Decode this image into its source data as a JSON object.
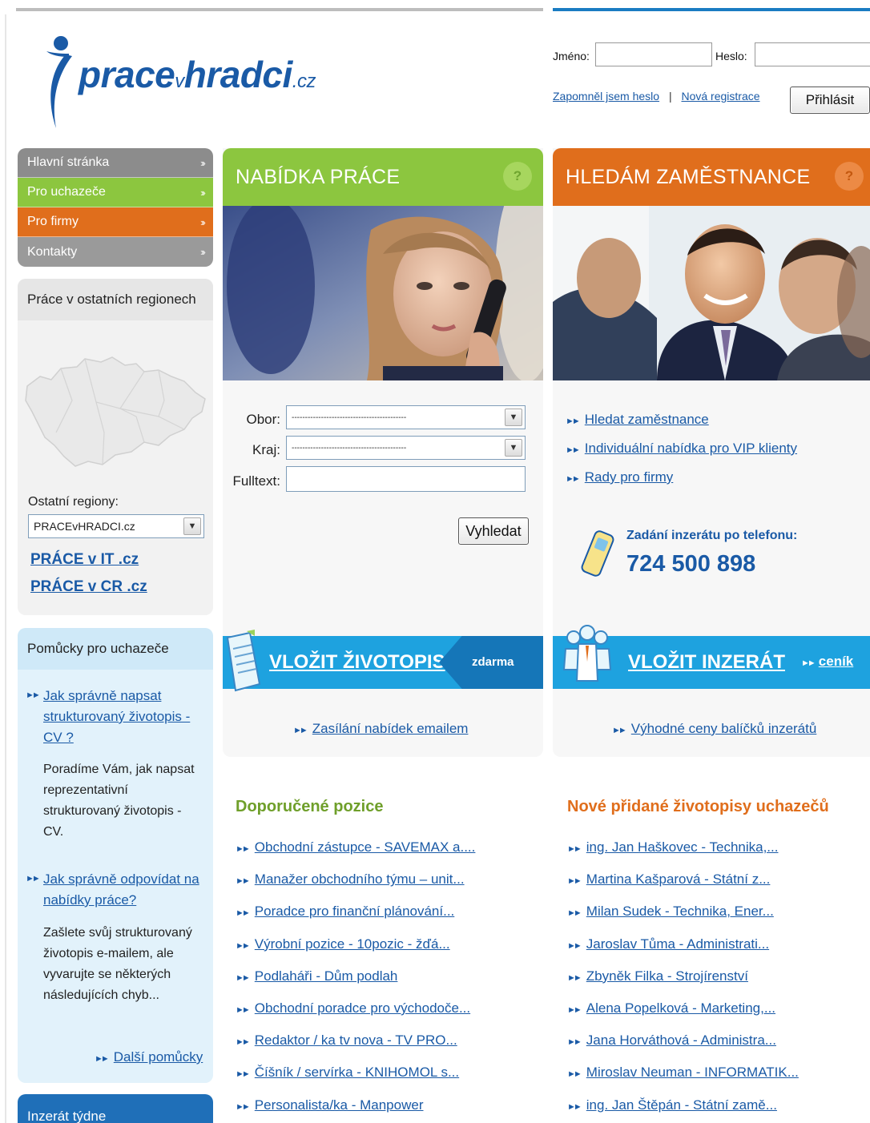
{
  "logo": {
    "text_main": "prace",
    "text_v": "v",
    "text_main2": "hradci",
    "text_tld": ".cz"
  },
  "login": {
    "name_label": "Jméno:",
    "password_label": "Heslo:",
    "forgot": "Zapomněl jsem heslo",
    "separator": "|",
    "register": "Nová registrace",
    "submit": "Přihlásit"
  },
  "nav": {
    "items": [
      {
        "label": "Hlavní stránka",
        "color": "#8c8c8c"
      },
      {
        "label": "Pro uchazeče",
        "color": "#8cc63f"
      },
      {
        "label": "Pro firmy",
        "color": "#e06e1c"
      },
      {
        "label": "Kontakty",
        "color": "#9a9a9a"
      }
    ]
  },
  "regions": {
    "title": "Práce v ostatních regionech",
    "other_label": "Ostatní regiony:",
    "selected": "PRACEvHRADCI.cz",
    "link1": "PRÁCE v IT .cz",
    "link2": "PRÁCE v CR .cz"
  },
  "aids": {
    "title": "Pomůcky pro uchazeče",
    "item1_link": "Jak správně napsat strukturovaný životopis - CV ?",
    "item1_text": "Poradíme Vám, jak napsat reprezentativní strukturovaný životopis - CV.",
    "item2_link": "Jak správně odpovídat na nabídky práce?",
    "item2_text": "Zašlete svůj strukturovaný životopis e-mailem, ale vyvarujte se některých následujících chyb...",
    "more": "Další pomůcky"
  },
  "week": {
    "title": "Inzerát týdne"
  },
  "offers": {
    "title": "NABÍDKA PRÁCE",
    "help": "?",
    "field_label": "Obor:",
    "region_label": "Kraj:",
    "fulltext_label": "Fulltext:",
    "field_value": "-------------------------------------------",
    "region_value": "-------------------------------------------",
    "search": "Vyhledat",
    "cv_banner": "VLOŽIT ŽIVOTOPIS",
    "cv_free": "zdarma",
    "email_link": "Zasílání nabídek emailem",
    "accent": "#8cc63f"
  },
  "employers": {
    "title": "HLEDÁM ZAMĚSTNANCE",
    "help": "?",
    "links": [
      "Hledat zaměstnance",
      "Individuální nabídka pro VIP klienty",
      "Rady pro firmy"
    ],
    "phone_label": "Zadání inzerátu po telefonu:",
    "phone": "724 500 898",
    "ad_banner": "VLOŽIT INZERÁT",
    "pricelist": "ceník",
    "packages_link": "Výhodné ceny balíčků inzerátů",
    "accent": "#e06e1c"
  },
  "recommended": {
    "title": "Doporučené pozice",
    "items": [
      "Obchodní zástupce - SAVEMAX a....",
      "Manažer obchodního týmu – unit...",
      "Poradce pro finanční plánování...",
      "Výrobní pozice - 10pozic - žďá...",
      "Podlaháři - Dům podlah",
      "Obchodní poradce pro východoče...",
      "Redaktor / ka tv nova - TV PRO...",
      "Číšník / servírka - KNIHOMOL s...",
      "Personalista/ka - Manpower"
    ]
  },
  "new_cvs": {
    "title": "Nové přidané životopisy uchazečů",
    "items": [
      "ing. Jan Haškovec - Technika,...",
      "Martina Kašparová - Státní z...",
      "Milan Sudek - Technika, Ener...",
      "Jaroslav Tůma - Administrati...",
      "Zbyněk Filka - Strojírenství",
      "Alena Popelková - Marketing,...",
      "Jana Horváthová - Administra...",
      "Miroslav Neuman - INFORMATIK...",
      "ing. Jan Štěpán - Státní zamě..."
    ]
  }
}
